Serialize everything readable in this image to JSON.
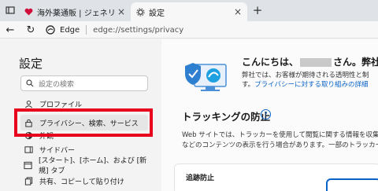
{
  "tabs": [
    {
      "label": "海外薬通販 | ジェネリック医薬品",
      "active": false
    },
    {
      "label": "設定",
      "active": true
    }
  ],
  "address": {
    "site_label": "Edge",
    "url": "edge://settings/privacy"
  },
  "sidebar": {
    "title": "設定",
    "search_placeholder": "設定の検索",
    "items": [
      {
        "label": "プロファイル",
        "icon": "profile-icon"
      },
      {
        "label": "プライバシー、検索、サービス",
        "icon": "lock-icon",
        "selected": true
      },
      {
        "label": "外観",
        "icon": "appearance-icon"
      },
      {
        "label": "サイドバー",
        "icon": "sidebar-icon"
      },
      {
        "label": "[スタート]、[ホーム]、および [新規] タブ",
        "icon": "home-icon"
      },
      {
        "label": "共有、コピーして貼り付け",
        "icon": "share-icon"
      }
    ]
  },
  "main": {
    "greeting_before": "こんにちは、",
    "greeting_after": "さん。弊社では",
    "intro_line1": "弊社では、お客様が期待される透明性と制",
    "intro_line2_prefix": "す。",
    "intro_link": "プライバシーに対する取り組みの詳細",
    "tracking_title": "トラッキングの防止",
    "desc_line1": "Web サイトでは、トラッカーを使用して閲覧に関する情報を収集します。Web",
    "desc_line2": "などのコンテンツの表示を行う場合があります。一部のトラッカーでは、ユーザ",
    "card_title": "追跡防止"
  },
  "colors": {
    "accent": "#0a64c8",
    "highlight": "#e8001c"
  }
}
